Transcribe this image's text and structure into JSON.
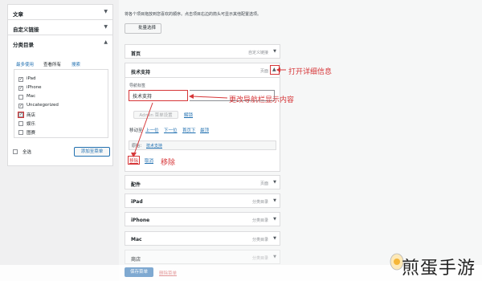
{
  "left_panel": {
    "accordion": [
      {
        "label": "文章"
      },
      {
        "label": "自定义链接"
      },
      {
        "label": "分类目录"
      }
    ],
    "tabs": [
      "最多使用",
      "查看所有",
      "搜索"
    ],
    "categories": [
      {
        "label": "iPad",
        "checked": true
      },
      {
        "label": "iPhone",
        "checked": true
      },
      {
        "label": "Mac",
        "checked": false
      },
      {
        "label": "Uncategorized",
        "checked": true
      },
      {
        "label": "商店",
        "checked": true
      },
      {
        "label": "娱乐",
        "checked": false
      },
      {
        "label": "图赛",
        "checked": false
      }
    ],
    "select_all": "全选",
    "add_to_menu": "添加至菜单"
  },
  "main": {
    "instruction": "将各个项目拖放到您喜欢的顺序。点击项目右边的箭头可显示其他配置选项。",
    "bulk_select": "批量选择",
    "items": [
      {
        "title": "首页",
        "type": "自定义链接"
      },
      {
        "title": "技术支持",
        "type": "页面"
      },
      {
        "title": "配件",
        "type": "页面"
      },
      {
        "title": "iPad",
        "type": "分类目录"
      },
      {
        "title": "iPhone",
        "type": "分类目录"
      },
      {
        "title": "Mac",
        "type": "分类目录"
      },
      {
        "title": "商店",
        "type": "分类目录"
      }
    ],
    "expanded": {
      "nav_label_caption": "导航标签",
      "nav_label_value": "技术支持",
      "admin_menu_settings": "Admin 菜单设置",
      "unlink": "解锁",
      "move_label": "移动至",
      "move_links": [
        "上一位",
        "下一位",
        "首页下",
        "最顶"
      ],
      "original_label": "原始：",
      "original_link": "技术支持",
      "remove": "移除",
      "cancel": "取消"
    },
    "save_button": "保存菜单",
    "delete_menu": "删除菜单"
  },
  "annotations": {
    "open_details": "打开详细信息",
    "change_nav": "更改导航栏显示内容",
    "remove": "移除"
  },
  "watermark": {
    "text": "煎蛋手游"
  },
  "colors": {
    "accent": "#2271b1",
    "annotation": "#d63638"
  }
}
